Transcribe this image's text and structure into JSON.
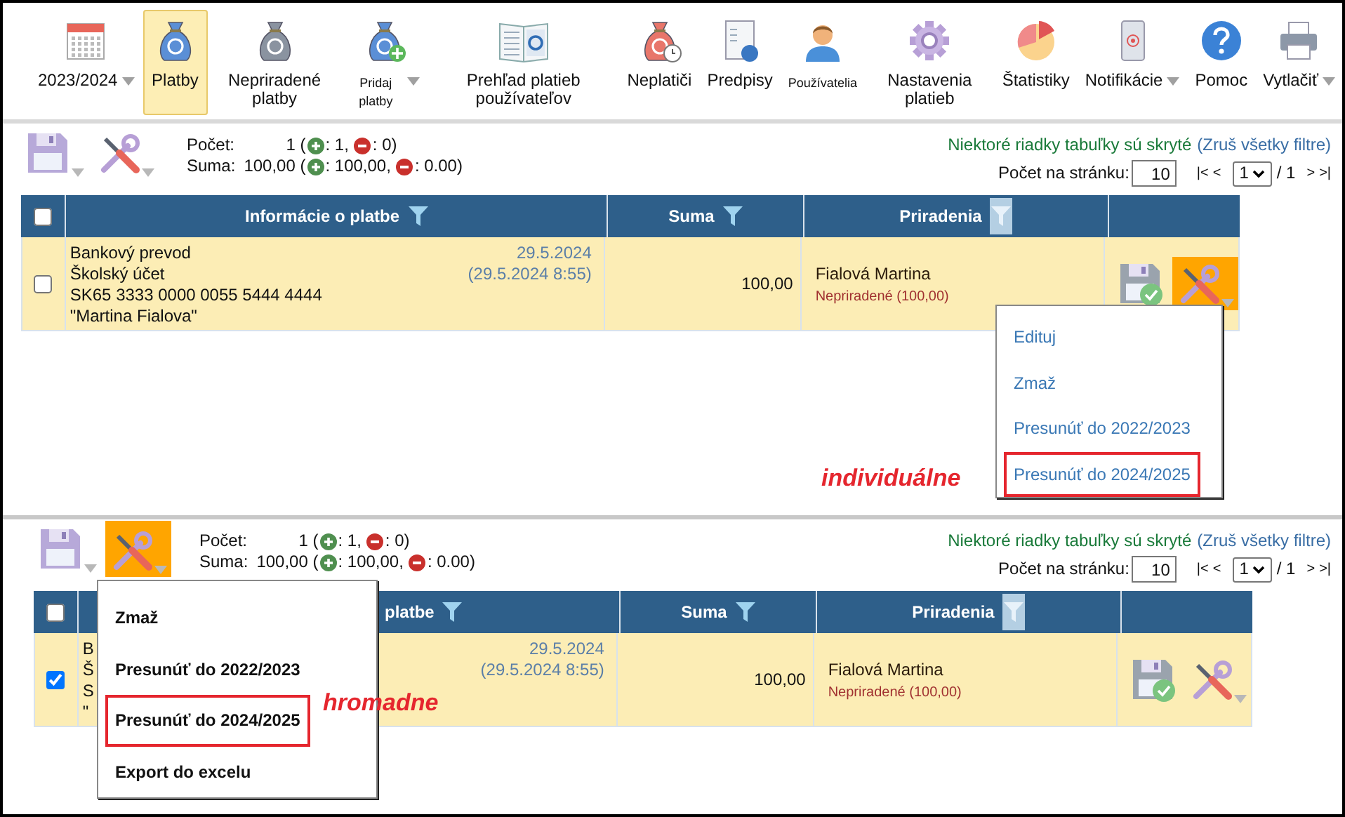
{
  "toolbar": {
    "items": [
      {
        "label": "2023/2024",
        "selected": false,
        "dropdown": true,
        "small": false
      },
      {
        "label": "Platby",
        "selected": true,
        "dropdown": false,
        "small": false
      },
      {
        "label": "Nepriradené platby",
        "selected": false,
        "dropdown": false,
        "small": false
      },
      {
        "label": "Pridaj platby",
        "selected": false,
        "dropdown": true,
        "small": true
      },
      {
        "label": "Prehľad platieb používateľov",
        "selected": false,
        "dropdown": false,
        "small": false
      },
      {
        "label": "Neplatiči",
        "selected": false,
        "dropdown": false,
        "small": false
      },
      {
        "label": "Predpisy",
        "selected": false,
        "dropdown": false,
        "small": false
      },
      {
        "label": "Používatelia",
        "selected": false,
        "dropdown": false,
        "small": true
      },
      {
        "label": "Nastavenia platieb",
        "selected": false,
        "dropdown": false,
        "small": false
      },
      {
        "label": "Štatistiky",
        "selected": false,
        "dropdown": false,
        "small": false
      },
      {
        "label": "Notifikácie",
        "selected": false,
        "dropdown": true,
        "small": false
      },
      {
        "label": "Pomoc",
        "selected": false,
        "dropdown": false,
        "small": false
      },
      {
        "label": "Vytlačiť",
        "selected": false,
        "dropdown": true,
        "small": false
      }
    ]
  },
  "panels": [
    {
      "bulk_tools_open": false,
      "stats": [
        {
          "label": "Počet:",
          "value": "1 (",
          "plus": ": 1,",
          "minus": ": 0)"
        },
        {
          "label": "Suma:",
          "value": "100,00 (",
          "plus": ": 100,00,",
          "minus": ": 0.00)"
        }
      ],
      "filter_notice": {
        "text": "Niektoré riadky tabuľky sú skryté",
        "link": "(Zruš všetky filtre)"
      },
      "per_page": {
        "label": "Počet na stránku:",
        "value": "10"
      },
      "pagination": {
        "first": "|<",
        "prev": "<",
        "page": "1",
        "total": "/ 1",
        "next": ">",
        "last": ">|"
      },
      "table": {
        "select_all": false,
        "columns": [
          {
            "label": "Informácie o platbe",
            "filter_active": false
          },
          {
            "label": "Suma",
            "filter_active": false
          },
          {
            "label": "Priradenia",
            "filter_active": true
          }
        ],
        "rows": [
          {
            "checked": false,
            "info": [
              "Bankový prevod",
              "Školský účet",
              "SK65 3333 0000 0055 5444 4444",
              "\"Martina Fialova\""
            ],
            "date": "29.5.2024",
            "datetime": "(29.5.2024 8:55)",
            "amount": "100,00",
            "assignee": "Fialová Martina",
            "status": "Nepriradené (100,00)",
            "tools_open": true
          }
        ]
      },
      "menu": {
        "kind": "row",
        "items": [
          {
            "label": "Edituj",
            "highlighted": false
          },
          {
            "label": "Zmaž",
            "highlighted": false
          },
          {
            "label": "Presunúť do 2022/2023",
            "highlighted": false
          },
          {
            "label": "Presunúť do 2024/2025",
            "highlighted": true
          }
        ]
      },
      "annotation": "individuálne"
    },
    {
      "bulk_tools_open": true,
      "stats": [
        {
          "label": "Počet:",
          "value": "1 (",
          "plus": ": 1,",
          "minus": ": 0)"
        },
        {
          "label": "Suma:",
          "value": "100,00 (",
          "plus": ": 100,00,",
          "minus": ": 0.00)"
        }
      ],
      "filter_notice": {
        "text": "Niektoré riadky tabuľky sú skryté",
        "link": "(Zruš všetky filtre)"
      },
      "per_page": {
        "label": "Počet na stránku:",
        "value": "10"
      },
      "pagination": {
        "first": "|<",
        "prev": "<",
        "page": "1",
        "total": "/ 1",
        "next": ">",
        "last": ">|"
      },
      "table": {
        "select_all": false,
        "columns": [
          {
            "label": "platbe",
            "filter_active": false
          },
          {
            "label": "Suma",
            "filter_active": false
          },
          {
            "label": "Priradenia",
            "filter_active": true
          }
        ],
        "rows": [
          {
            "checked": true,
            "info": [
              "B",
              "Š",
              "S",
              "\""
            ],
            "date": "29.5.2024",
            "datetime": "(29.5.2024 8:55)",
            "amount": "100,00",
            "assignee": "Fialová Martina",
            "status": "Nepriradené (100,00)",
            "tools_open": false
          }
        ]
      },
      "menu": {
        "kind": "bulk",
        "items": [
          {
            "label": "Zmaž",
            "highlighted": false
          },
          {
            "label": "Presunúť do 2022/2023",
            "highlighted": false
          },
          {
            "label": "Presunúť do 2024/2025",
            "highlighted": true
          },
          {
            "label": "Export do excelu",
            "highlighted": false
          }
        ]
      },
      "annotation": "hromadne"
    }
  ]
}
